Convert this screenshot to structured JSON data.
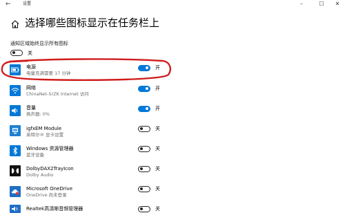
{
  "window": {
    "title": "设置",
    "back_glyph": "←",
    "minimize_glyph": "–",
    "maximize_glyph": "☐",
    "close_glyph": "✕"
  },
  "header": {
    "title": "选择哪些图标显示在任务栏上"
  },
  "always_show": {
    "label": "通知区域始终显示所有图标",
    "state": "关",
    "on": false
  },
  "items": [
    {
      "name": "电源",
      "subtitle": "电量充满需要 17 分钟",
      "state": "开",
      "on": true,
      "icon": "battery-icon",
      "icon_color": "#0078d7"
    },
    {
      "name": "网络",
      "subtitle": "ChinaNet-5rZK Internet 访问",
      "state": "开",
      "on": true,
      "icon": "wifi-icon",
      "icon_color": "#0078d7"
    },
    {
      "name": "音量",
      "subtitle": "扬声器: 0%",
      "state": "开",
      "on": true,
      "icon": "speaker-icon",
      "icon_color": "#0078d7"
    },
    {
      "name": "igfxEM Module",
      "subtitle": "英特尔® 显卡设置",
      "state": "关",
      "on": false,
      "icon": "intel-graphics-icon",
      "icon_color": "#1e7fd1"
    },
    {
      "name": "Windows 资源管理器",
      "subtitle": "蓝牙设备",
      "state": "关",
      "on": false,
      "icon": "bluetooth-icon",
      "icon_color": "#0078d7"
    },
    {
      "name": "DolbyDAX2TrayIcon",
      "subtitle": "Dolby Audio",
      "state": "关",
      "on": false,
      "icon": "dolby-icon",
      "icon_color": "#111111"
    },
    {
      "name": "Microsoft OneDrive",
      "subtitle": "OneDrive 尚未登录",
      "state": "关",
      "on": false,
      "icon": "onedrive-icon",
      "icon_color": "#1f6fc6"
    },
    {
      "name": "Realtek高清晰音频管理器",
      "subtitle": "",
      "state": "关",
      "on": false,
      "icon": "realtek-icon",
      "icon_color": "#1f6fc6"
    }
  ],
  "colors": {
    "accent": "#0078d7",
    "annotation": "#d01c1c"
  }
}
